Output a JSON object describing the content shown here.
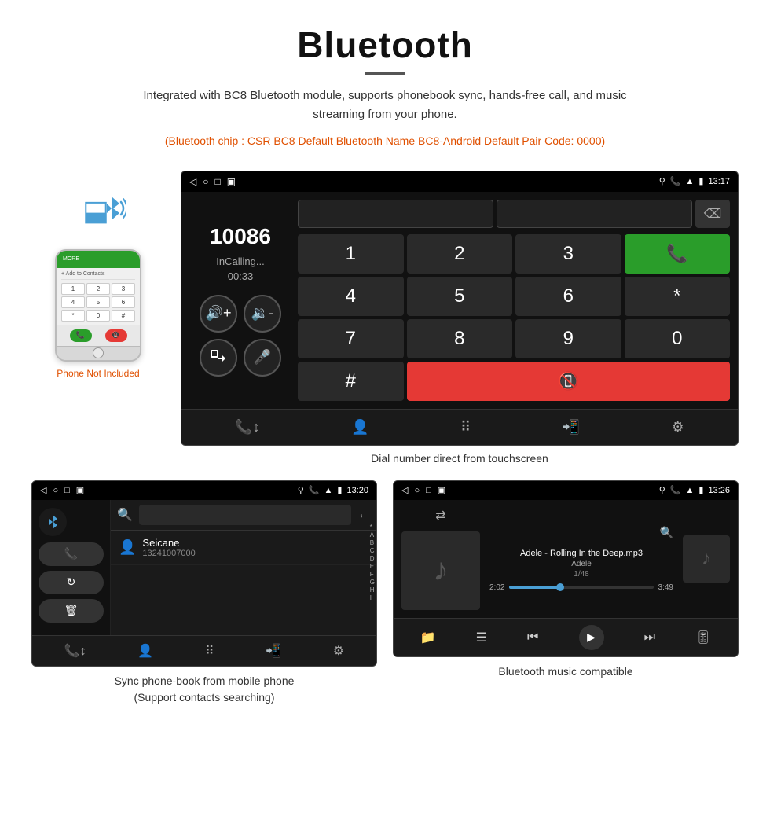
{
  "header": {
    "title": "Bluetooth",
    "description": "Integrated with BC8 Bluetooth module, supports phonebook sync, hands-free call, and music streaming from your phone.",
    "specs": "(Bluetooth chip : CSR BC8    Default Bluetooth Name BC8-Android    Default Pair Code: 0000)"
  },
  "dial_screen": {
    "status_time": "13:17",
    "phone_number": "10086",
    "calling_status": "InCalling...",
    "call_timer": "00:33",
    "keypad": [
      "1",
      "2",
      "3",
      "*",
      "4",
      "5",
      "6",
      "0",
      "7",
      "8",
      "9",
      "#"
    ],
    "caption": "Dial number direct from touchscreen"
  },
  "phonebook_screen": {
    "status_time": "13:20",
    "contact_name": "Seicane",
    "contact_number": "13241007000",
    "caption_line1": "Sync phone-book from mobile phone",
    "caption_line2": "(Support contacts searching)"
  },
  "music_screen": {
    "status_time": "13:26",
    "track_name": "Adele - Rolling In the Deep.mp3",
    "artist": "Adele",
    "track_count": "1/48",
    "time_current": "2:02",
    "time_total": "3:49",
    "caption": "Bluetooth music compatible"
  },
  "phone_not_included": "Phone Not Included",
  "alphabet_list": [
    "*",
    "A",
    "B",
    "C",
    "D",
    "E",
    "F",
    "G",
    "H",
    "I"
  ]
}
